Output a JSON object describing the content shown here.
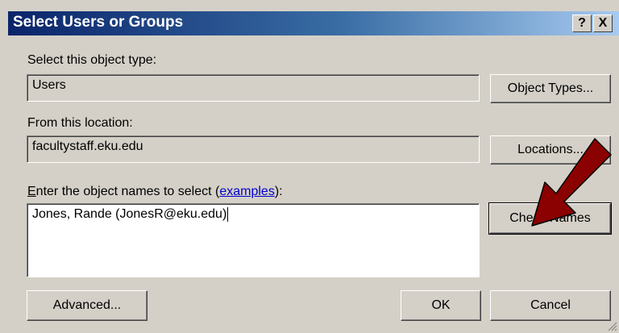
{
  "dialog": {
    "title": "Select Users or Groups",
    "help_label": "?",
    "close_label": "X",
    "object_type_label": "Select this object type:",
    "object_type_value": "Users",
    "object_types_button": "Object Types...",
    "location_label": "From this location:",
    "location_value": "facultystaff.eku.edu",
    "locations_button": "Locations...",
    "names_label_prefix": "nter the object names to select (",
    "names_label_accel": "E",
    "names_link": "examples",
    "names_label_suffix": "):",
    "names_value": "Jones, Rande (JonesR@eku.edu)",
    "check_names_button": "Check Names",
    "advanced_button": "Advanced...",
    "ok_button": "OK",
    "cancel_button": "Cancel"
  },
  "colors": {
    "title_start": "#0a246a",
    "title_end": "#a6caf0",
    "face": "#d4d0c8",
    "annotation_arrow": "#8b0000"
  }
}
